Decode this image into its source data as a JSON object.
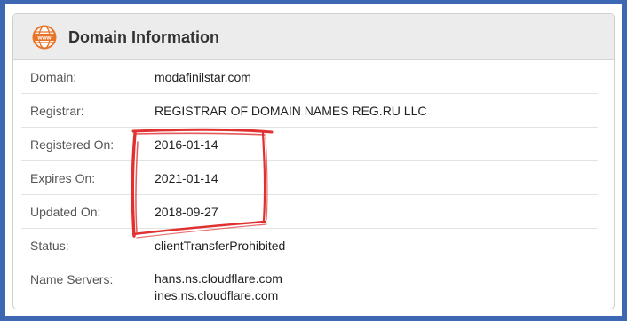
{
  "header": {
    "title": "Domain Information",
    "icon": "www-icon",
    "icon_text": "www",
    "accent": "#e8742a"
  },
  "rows": [
    {
      "label": "Domain:",
      "value": "modafinilstar.com"
    },
    {
      "label": "Registrar:",
      "value": "REGISTRAR OF DOMAIN NAMES REG.RU LLC"
    },
    {
      "label": "Registered On:",
      "value": "2016-01-14"
    },
    {
      "label": "Expires On:",
      "value": "2021-01-14"
    },
    {
      "label": "Updated On:",
      "value": "2018-09-27"
    },
    {
      "label": "Status:",
      "value": "clientTransferProhibited"
    },
    {
      "label": "Name Servers:",
      "values": [
        "hans.ns.cloudflare.com",
        "ines.ns.cloudflare.com"
      ]
    }
  ],
  "colors": {
    "frame": "#3d67b3",
    "annotation": "#e03030"
  }
}
